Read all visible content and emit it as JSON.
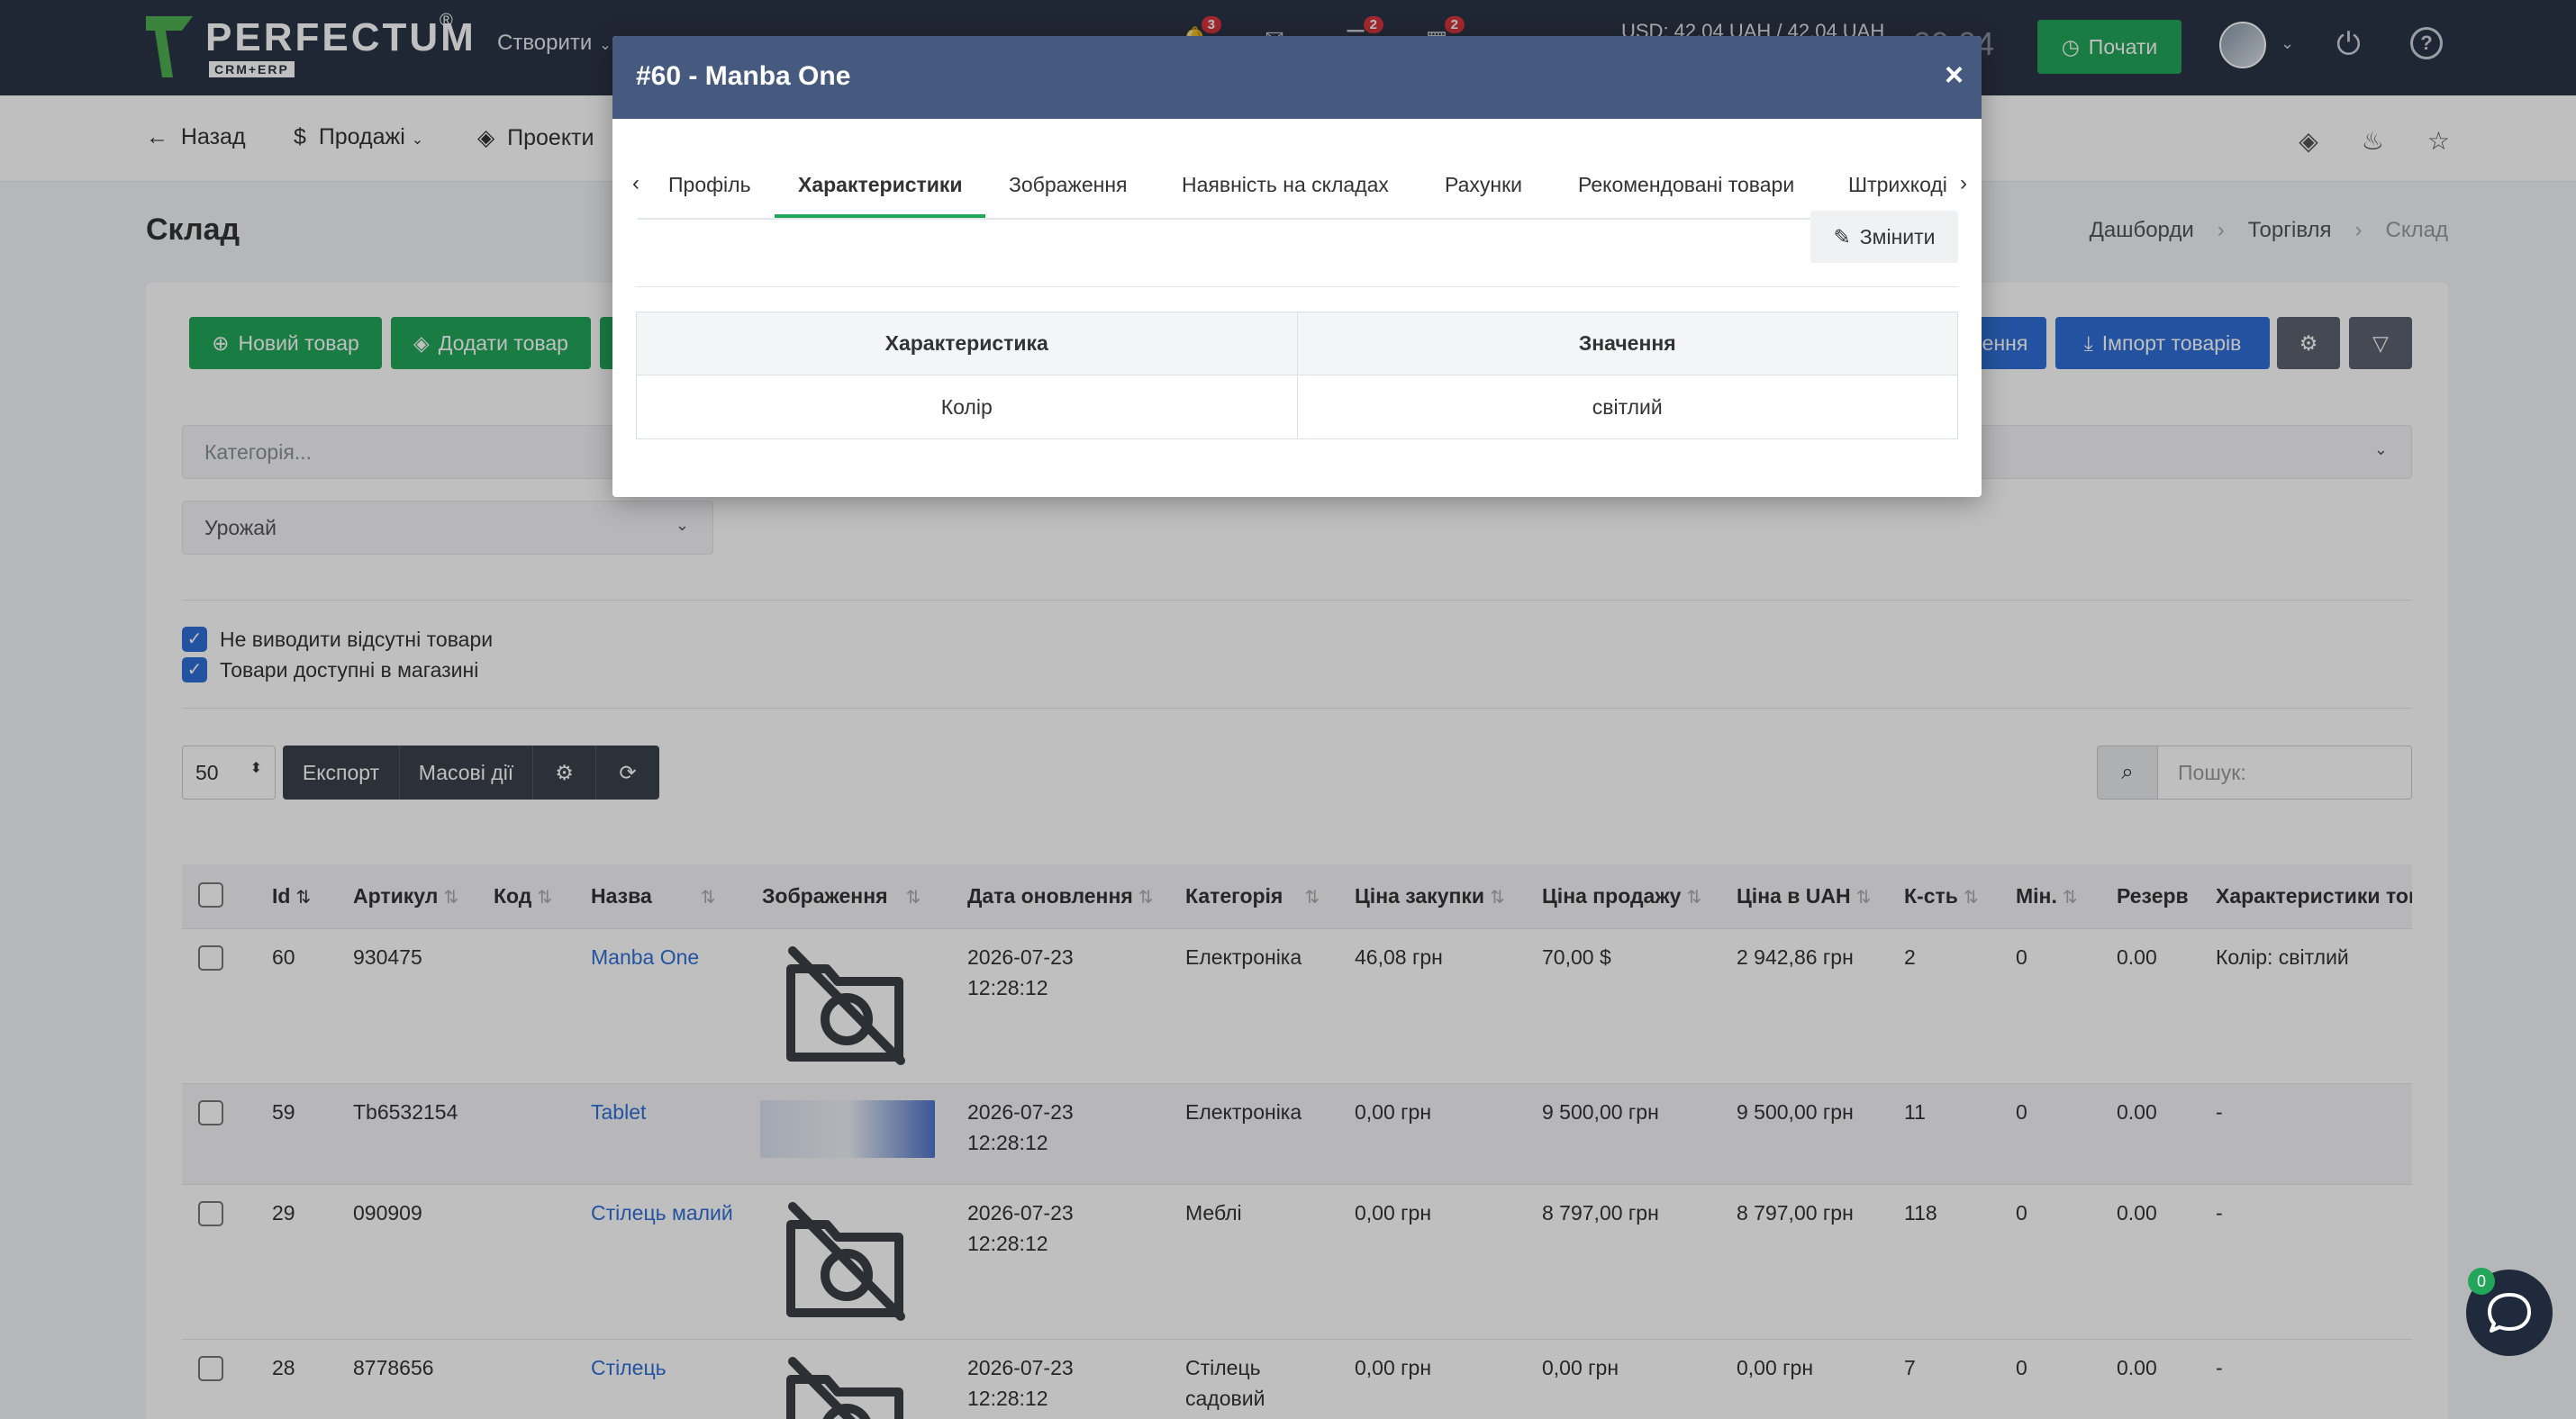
{
  "topbar": {
    "logo_text": "PERFECTUM",
    "logo_sub": "CRM+ERP",
    "logo_reg": "®",
    "create_label": "Створити",
    "badges": [
      "3",
      "2",
      "2"
    ],
    "rate": "USD: 42,04 UAH / 42,04 UAH",
    "clock": "09:04",
    "start_label": "Почати"
  },
  "subnav": {
    "back": "Назад",
    "sales": "Продажі",
    "projects": "Проекти"
  },
  "page": {
    "title": "Склад",
    "breadcrumbs": [
      "Дашборди",
      "Торгівля",
      "Склад"
    ]
  },
  "toolbar": {
    "new_product": "Новий товар",
    "add_product": "Додати товар",
    "update_label": "ення",
    "import_label": "Імпорт товарів"
  },
  "filters": {
    "category_placeholder": "Категорія...",
    "crop_value": "Урожай",
    "hide_missing": "Не виводити відсутні товари",
    "in_store": "Товари доступні в магазині"
  },
  "list_controls": {
    "per_page": "50",
    "export": "Експорт",
    "bulk": "Масові дії",
    "search_placeholder": "Пошук:"
  },
  "table": {
    "columns": [
      "Id",
      "Артикул",
      "Код",
      "Назва",
      "Зображення",
      "Дата оновлення",
      "Категорія",
      "Ціна закупки",
      "Ціна продажу",
      "Ціна в UAH",
      "К-сть",
      "Мін.",
      "Резерв",
      "Характеристики тов"
    ],
    "rows": [
      {
        "id": "60",
        "sku": "930475",
        "code": "",
        "name": "Manba One",
        "date1": "2026-07-23",
        "date2": "12:28:12",
        "category": "Електроніка",
        "category2": "",
        "buy": "46,08 грн",
        "sell": "70,00 $",
        "uah": "2 942,86 грн",
        "qty": "2",
        "min": "0",
        "reserve": "0.00",
        "chars": "Колір: світлий"
      },
      {
        "id": "59",
        "sku": "Tb6532154",
        "code": "",
        "name": "Tablet",
        "date1": "2026-07-23",
        "date2": "12:28:12",
        "category": "Електроніка",
        "category2": "",
        "buy": "0,00 грн",
        "sell": "9 500,00 грн",
        "uah": "9 500,00 грн",
        "qty": "11",
        "min": "0",
        "reserve": "0.00",
        "chars": "-"
      },
      {
        "id": "29",
        "sku": "090909",
        "code": "",
        "name": "Стілець малий",
        "date1": "2026-07-23",
        "date2": "12:28:12",
        "category": "Меблі",
        "category2": "",
        "buy": "0,00 грн",
        "sell": "8 797,00 грн",
        "uah": "8 797,00 грн",
        "qty": "118",
        "min": "0",
        "reserve": "0.00",
        "chars": "-"
      },
      {
        "id": "28",
        "sku": "8778656",
        "code": "",
        "name": "Стілець",
        "date1": "2026-07-23",
        "date2": "12:28:12",
        "category": "Стілець",
        "category2": "садовий",
        "buy": "0,00 грн",
        "sell": "0,00 грн",
        "uah": "0,00 грн",
        "qty": "7",
        "min": "0",
        "reserve": "0.00",
        "chars": "-"
      }
    ]
  },
  "modal": {
    "title": "#60 - Manba One",
    "close": "×",
    "tabs": [
      "Профіль",
      "Характеристики",
      "Зображення",
      "Наявність на складах",
      "Рахунки",
      "Рекомендовані товари",
      "Штрихкоді"
    ],
    "active_tab": "Характеристики",
    "edit_label": "Змінити",
    "table_headers": [
      "Характеристика",
      "Значення"
    ],
    "table_rows": [
      [
        "Колір",
        "світлий"
      ]
    ]
  },
  "chat": {
    "badge": "0"
  },
  "colors": {
    "primary_dark": "#2b3446",
    "green": "#22a65a",
    "blue": "#2f6fd6",
    "modal_header": "#465a80"
  }
}
